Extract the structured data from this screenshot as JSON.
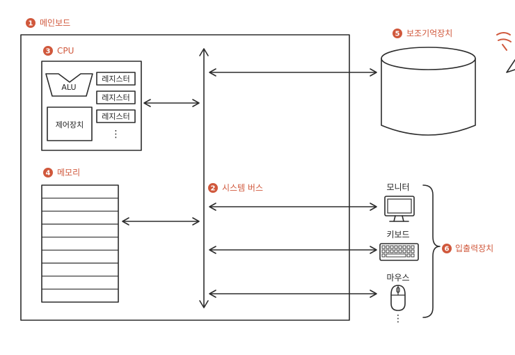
{
  "labels": {
    "mainboard": {
      "num": "1",
      "text": "메인보드"
    },
    "system_bus": {
      "num": "2",
      "text": "시스템 버스"
    },
    "cpu": {
      "num": "3",
      "text": "CPU"
    },
    "memory": {
      "num": "4",
      "text": "메모리"
    },
    "storage": {
      "num": "5",
      "text": "보조기억장치"
    },
    "io": {
      "num": "6",
      "text": "입출력장치"
    }
  },
  "cpu": {
    "alu": "ALU",
    "control_unit": "제어장치",
    "registers": [
      "레지스터",
      "레지스터",
      "레지스터"
    ],
    "more": "⋮"
  },
  "devices": {
    "monitor": "모니터",
    "keyboard": "키보드",
    "mouse": "마우스",
    "more": "⋮"
  },
  "colors": {
    "accent": "#d0583c",
    "line": "#2b2b2b"
  }
}
